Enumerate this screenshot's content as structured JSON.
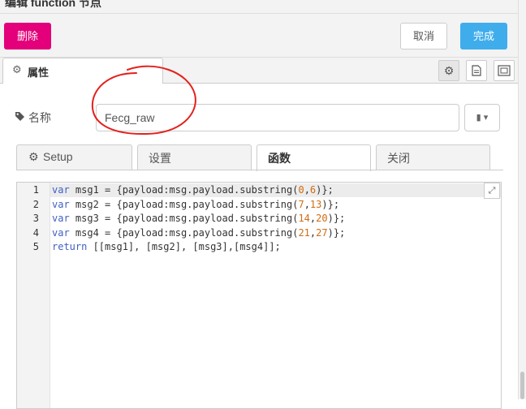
{
  "dialog": {
    "title": "编辑 function 节点"
  },
  "toolbar": {
    "delete_label": "删除",
    "cancel_label": "取消",
    "done_label": "完成"
  },
  "tabs": {
    "properties_label": "属性"
  },
  "form": {
    "name_label": "名称",
    "name_value": "Fecg_raw"
  },
  "subtabs": [
    {
      "label": "Setup"
    },
    {
      "label": "设置"
    },
    {
      "label": "函数",
      "active": true
    },
    {
      "label": "关闭"
    }
  ],
  "editor": {
    "line_numbers": [
      "1",
      "2",
      "3",
      "4",
      "5"
    ],
    "lines": [
      [
        {
          "t": "var",
          "c": "kw"
        },
        {
          "t": " msg1 = {payload:msg.payload.substring("
        },
        {
          "t": "0",
          "c": "num"
        },
        {
          "t": ","
        },
        {
          "t": "6",
          "c": "num"
        },
        {
          "t": ")};"
        }
      ],
      [
        {
          "t": "var",
          "c": "kw"
        },
        {
          "t": " msg2 = {payload:msg.payload.substring("
        },
        {
          "t": "7",
          "c": "num"
        },
        {
          "t": ","
        },
        {
          "t": "13",
          "c": "num"
        },
        {
          "t": ")};"
        }
      ],
      [
        {
          "t": "var",
          "c": "kw"
        },
        {
          "t": " msg3 = {payload:msg.payload.substring("
        },
        {
          "t": "14",
          "c": "num"
        },
        {
          "t": ","
        },
        {
          "t": "20",
          "c": "num"
        },
        {
          "t": ")};"
        }
      ],
      [
        {
          "t": "var",
          "c": "kw"
        },
        {
          "t": " msg4 = {payload:msg.payload.substring("
        },
        {
          "t": "21",
          "c": "num"
        },
        {
          "t": ","
        },
        {
          "t": "27",
          "c": "num"
        },
        {
          "t": ")};"
        }
      ],
      [
        {
          "t": "return",
          "c": "kw"
        },
        {
          "t": " [[msg1], [msg2], [msg3],[msg4]];"
        }
      ]
    ]
  },
  "icons": {
    "properties_tab": "gear-icon",
    "side_tabs": [
      "gear-icon",
      "document-icon",
      "frame-icon"
    ],
    "name_label": "tag-icon",
    "name_lookup": "book-icon",
    "setup_tab": "gear-icon",
    "editor_expand": "expand-icon"
  },
  "colors": {
    "delete_button": "#e3007a",
    "done_button": "#3fadec",
    "keyword": "#4060c4",
    "number": "#d06c12",
    "annotation_circle": "#e3201b"
  }
}
